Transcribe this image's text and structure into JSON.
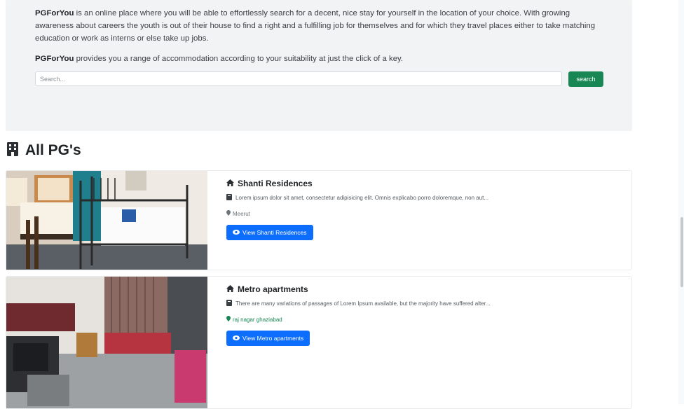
{
  "hero": {
    "brand": "PGForYou",
    "para1_rest": " is an online place where you will be able to effortlessly search for a decent, nice stay for yourself in the location of your choice. With growing awareness about careers the youth is out of their house to find a right and a fulfilling job for themselves and for which they travel places either to take matching education or work as interns or else take up jobs.",
    "para2_rest": " provides you a range of accommodation according to your suitability at just the click of a key.",
    "search_placeholder": "Search...",
    "search_button": "search"
  },
  "section": {
    "title": "All PG's",
    "icon": "building-icon"
  },
  "listings": [
    {
      "name": "Shanti Residences",
      "description": "Lorem ipsum dolor sit amet, consectetur adipisicing elit. Omnis explicabo porro doloremque, non aut...",
      "location": "Meerut",
      "button": "View Shanti Residences"
    },
    {
      "name": "Metro apartments",
      "description": "There are many variations of passages of Lorem Ipsum available, but the majority have suffered alter...",
      "location": "raj nagar ghaziabad",
      "button": "View Metro apartments"
    }
  ],
  "colors": {
    "hero_bg": "#f1f3f5",
    "search_btn": "#198754",
    "view_btn": "#0d6efd"
  }
}
